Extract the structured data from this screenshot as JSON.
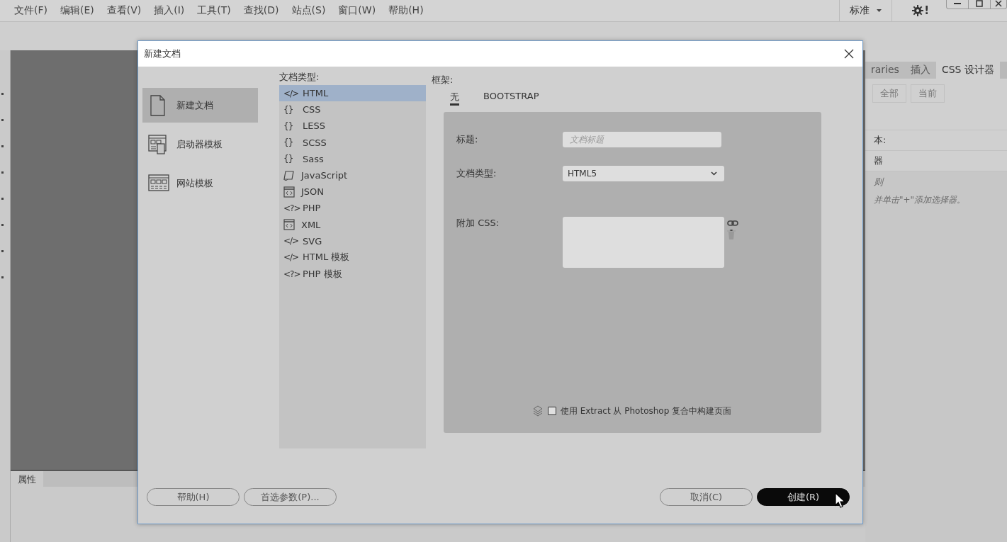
{
  "menu": [
    "文件(F)",
    "编辑(E)",
    "查看(V)",
    "插入(I)",
    "工具(T)",
    "查找(D)",
    "站点(S)",
    "窗口(W)",
    "帮助(H)"
  ],
  "workspace": {
    "label": "标准",
    "alert_mark": "!"
  },
  "properties_tab": "属性",
  "right_panel": {
    "tabs": [
      {
        "label": "raries",
        "selected": false
      },
      {
        "label": "插入",
        "selected": false
      },
      {
        "label": "CSS 设计器",
        "selected": true
      }
    ],
    "filters": [
      "全部",
      "当前"
    ],
    "rows": [
      "本:",
      "器"
    ],
    "hint_title": "则",
    "hint": "并单击\"+\"添加选择器。"
  },
  "dialog": {
    "title": "新建文档",
    "nav": [
      {
        "kind": "page",
        "label": "新建文档",
        "selected": true
      },
      {
        "kind": "starter",
        "label": "启动器模板",
        "selected": false
      },
      {
        "kind": "site",
        "label": "网站模板",
        "selected": false
      }
    ],
    "types_header": "文档类型:",
    "types": [
      {
        "kind": "glyph",
        "glyph": "</>",
        "label": "HTML",
        "selected": true
      },
      {
        "kind": "glyph",
        "glyph": "{}",
        "label": "CSS",
        "selected": false
      },
      {
        "kind": "glyph",
        "glyph": "{}",
        "label": "LESS",
        "selected": false
      },
      {
        "kind": "glyph",
        "glyph": "{}",
        "label": "SCSS",
        "selected": false
      },
      {
        "kind": "glyph",
        "glyph": "{}",
        "label": "Sass",
        "selected": false
      },
      {
        "kind": "script",
        "label": "JavaScript",
        "selected": false
      },
      {
        "kind": "window",
        "label": "JSON",
        "selected": false
      },
      {
        "kind": "glyph",
        "glyph": "<?>",
        "label": "PHP",
        "selected": false
      },
      {
        "kind": "window",
        "label": "XML",
        "selected": false
      },
      {
        "kind": "glyph",
        "glyph": "</>",
        "label": "SVG",
        "selected": false
      },
      {
        "kind": "glyph",
        "glyph": "</>",
        "label": "HTML 模板",
        "selected": false
      },
      {
        "kind": "glyph",
        "glyph": "<?>",
        "label": "PHP 模板",
        "selected": false
      }
    ],
    "framework_label": "框架:",
    "framework_tabs": [
      {
        "label": "无",
        "selected": true
      },
      {
        "label": "BOOTSTRAP",
        "selected": false
      }
    ],
    "title_field": {
      "label": "标题:",
      "placeholder": "文档标题"
    },
    "doctype_field": {
      "label": "文档类型:",
      "value": "HTML5"
    },
    "css_field": {
      "label": "附加 CSS:"
    },
    "extract": {
      "label": "使用 Extract 从 Photoshop 复合中构建页面",
      "checked": false
    },
    "buttons": [
      {
        "kind": "plain",
        "label": "帮助(H)"
      },
      {
        "kind": "plain",
        "label": "首选参数(P)..."
      },
      {
        "kind": "spacer"
      },
      {
        "kind": "plain",
        "label": "取消(C)"
      },
      {
        "kind": "primary",
        "label": "创建(R)"
      }
    ]
  }
}
